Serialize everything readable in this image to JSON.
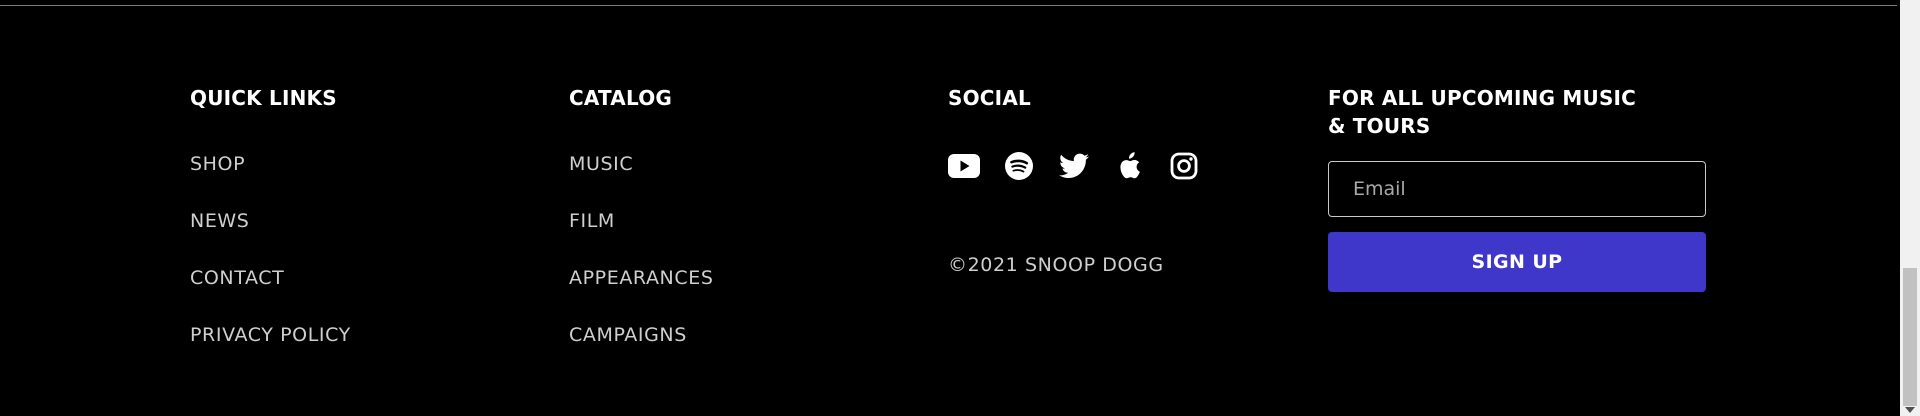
{
  "footer": {
    "quick_links": {
      "heading": "QUICK LINKS",
      "items": [
        {
          "label": "SHOP"
        },
        {
          "label": "NEWS"
        },
        {
          "label": "CONTACT"
        },
        {
          "label": "PRIVACY POLICY"
        }
      ]
    },
    "catalog": {
      "heading": "CATALOG",
      "items": [
        {
          "label": "MUSIC"
        },
        {
          "label": "FILM"
        },
        {
          "label": "APPEARANCES"
        },
        {
          "label": "CAMPAIGNS"
        }
      ]
    },
    "social": {
      "heading": "SOCIAL",
      "icons": [
        "youtube-icon",
        "spotify-icon",
        "twitter-icon",
        "apple-icon",
        "instagram-icon"
      ],
      "copyright": "©2021 SNOOP DOGG"
    },
    "signup": {
      "heading": "FOR ALL UPCOMING MUSIC & TOURS",
      "email_placeholder": "Email",
      "email_value": "",
      "button_label": "SIGN UP",
      "button_color": "#3f37c9"
    }
  },
  "colors": {
    "background": "#000000",
    "heading": "#ffffff",
    "link": "#cfcfcf",
    "accent": "#3f37c9"
  }
}
